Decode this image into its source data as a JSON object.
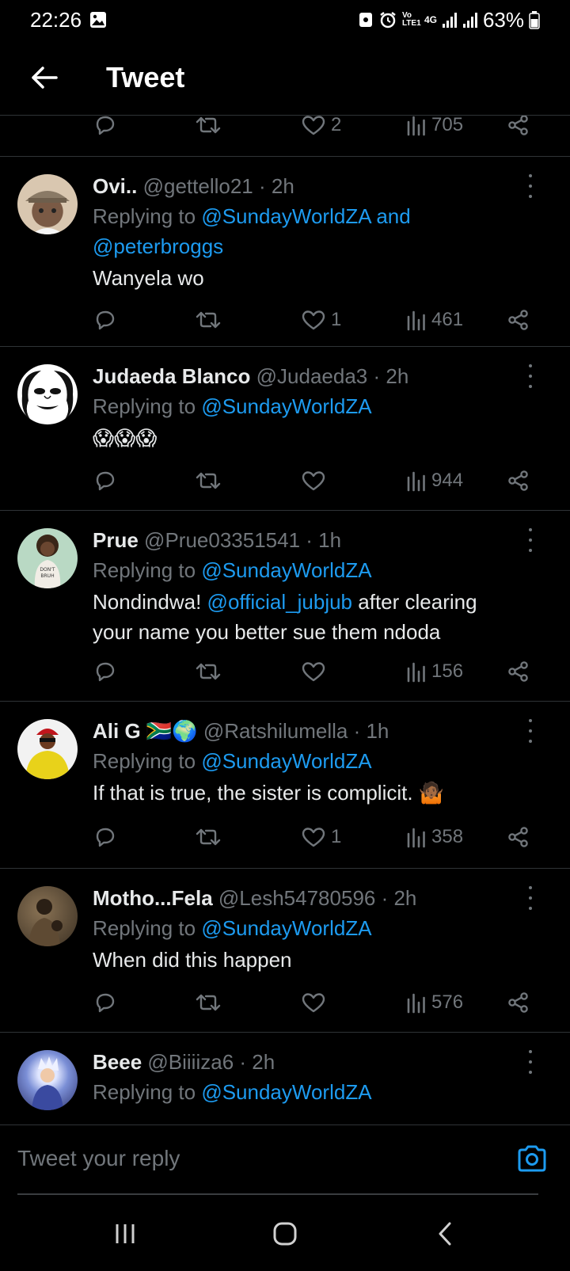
{
  "status_bar": {
    "time": "22:26",
    "network": "4G",
    "volte": "Vo LTE1",
    "battery": "63%"
  },
  "header": {
    "title": "Tweet"
  },
  "partial_tweet": {
    "likes": "2",
    "views": "705"
  },
  "tweets": [
    {
      "name": "Ovi..",
      "handle": "@gettello21",
      "time": "· 2h",
      "replying_prefix": "Replying to ",
      "replying_to": "@SundayWorldZA and",
      "replying_to_2": "@peterbroggs",
      "text": "Wanyela wo",
      "likes": "1",
      "views": "461",
      "avatar_colors": [
        "#8a6a55",
        "#d9c7b0"
      ]
    },
    {
      "name": "Judaeda Blanco",
      "handle": "@Judaeda3",
      "time": "· 2h",
      "replying_prefix": "Replying to ",
      "replying_to": "@SundayWorldZA",
      "text": "😱😱😱",
      "likes": "",
      "views": "944",
      "avatar_colors": [
        "#ffffff",
        "#111111"
      ]
    },
    {
      "name": "Prue",
      "handle": "@Prue03351541",
      "time": "· 1h",
      "replying_prefix": "Replying to ",
      "replying_to": "@SundayWorldZA",
      "text_mention": "@official_jubjub",
      "text_before": "Nondindwa! ",
      "text_after": " after clearing your name you better sue them ndoda",
      "likes": "",
      "views": "156",
      "avatar_colors": [
        "#b9d9c4",
        "#5a3d2a"
      ]
    },
    {
      "name": "Ali G 🇿🇦🌍",
      "handle": "@Ratshilumella",
      "time": "· 1h",
      "replying_prefix": "Replying to ",
      "replying_to": "@SundayWorldZA",
      "text": "If that is true, the sister is complicit. 🤷🏾",
      "likes": "1",
      "views": "358",
      "avatar_colors": [
        "#e8d21a",
        "#6b3a20"
      ]
    },
    {
      "name": "Motho...Fela",
      "handle": "@Lesh54780596",
      "time": "· 2h",
      "replying_prefix": "Replying to ",
      "replying_to": "@SundayWorldZA",
      "text": "When did this happen",
      "likes": "",
      "views": "576",
      "avatar_colors": [
        "#6e5a40",
        "#2a231a"
      ]
    },
    {
      "name": "Beee",
      "handle": "@Biiiiza6",
      "time": "· 2h",
      "replying_prefix": "Replying to ",
      "replying_to": "@SundayWorldZA",
      "avatar_colors": [
        "#7b8fd6",
        "#e0e6ff"
      ]
    }
  ],
  "reply_bar": {
    "placeholder": "Tweet your reply"
  },
  "colors": {
    "accent": "#1d9bf0",
    "muted": "#71767b",
    "divider": "#2f3336"
  }
}
